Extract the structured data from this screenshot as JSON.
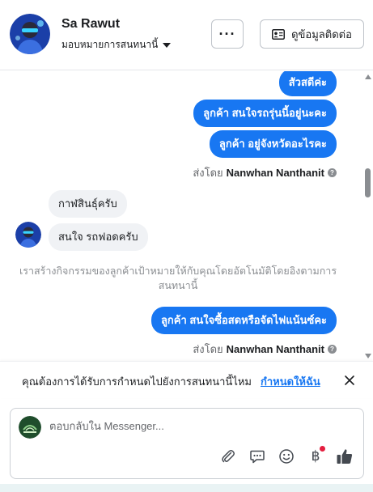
{
  "header": {
    "name": "Sa Rawut",
    "assign_label": "มอบหมายการสนทนานี้",
    "more_label": "···",
    "contact_label": "ดูข้อมูลติดต่อ"
  },
  "messages": [
    {
      "type": "out",
      "text": "สัวสดีค่ะ"
    },
    {
      "type": "out",
      "text": "ลูกค้า สนใจรถรุ่นนี้อยู่นะคะ"
    },
    {
      "type": "out",
      "text": "ลูกค้า   อยู่จังหวัดอะไรคะ"
    },
    {
      "type": "sent_by",
      "prefix": "ส่งโดย",
      "sender": "Nanwhan Nanthanit"
    },
    {
      "type": "in",
      "text": "กาฬสินธุ์ครับ"
    },
    {
      "type": "in",
      "text": "สนใจ รถฟอดครับ"
    },
    {
      "type": "system",
      "text": "เราสร้างกิจกรรมของลูกค้าเป้าหมายให้กับคุณโดยอัตโนมัติโดยอิงตามการสนทนานี้"
    },
    {
      "type": "out",
      "text": "ลูกค้า สนใจซื้อสดหรือจัดไฟแน้นซ์คะ"
    },
    {
      "type": "sent_by",
      "prefix": "ส่งโดย",
      "sender": "Nanwhan Nanthanit"
    }
  ],
  "banner": {
    "text": "คุณต้องการได้รับการกำหนดไปยังการสนทนานี้ไหม",
    "link": "กำหนดให้ฉัน"
  },
  "composer": {
    "placeholder": "ตอบกลับใน Messenger...",
    "baht_symbol": "฿"
  },
  "colors": {
    "accent": "#1877f2",
    "incoming_bubble": "#f0f2f5",
    "notification": "#e41e3f"
  }
}
